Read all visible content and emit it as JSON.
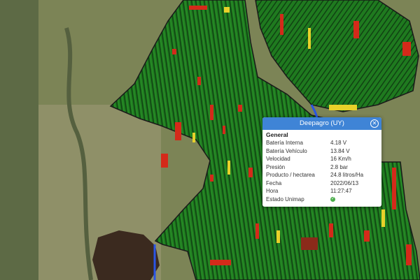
{
  "map": {
    "colors": {
      "field": "#1f7a1f",
      "row_dark": "#0f3e12",
      "row_light": "#2c9a2c",
      "rate_high": "#d42a1a",
      "rate_mid": "#e8d12a",
      "pasture": "#7c8456",
      "forest": "#3b2a1f",
      "route": "#2a55e6"
    }
  },
  "popup": {
    "title": "Deepagro (UY)",
    "close_icon": "close-icon",
    "section": "General",
    "rows": [
      {
        "label": "Batería Interna",
        "value": "4.18 V"
      },
      {
        "label": "Batería Vehículo",
        "value": "13.84 V"
      },
      {
        "label": "Velocidad",
        "value": "16 Km/h"
      },
      {
        "label": "Presión",
        "value": "2.8 bar"
      },
      {
        "label": "Producto / hectarea",
        "value": "24.8 litros/Ha"
      },
      {
        "label": "Fecha",
        "value": "2022/06/13"
      },
      {
        "label": "Hora",
        "value": "11:27:47"
      },
      {
        "label": "Estado Unimap",
        "value": "",
        "icon": "check-circle-icon",
        "status_color": "#4cae4c"
      }
    ]
  }
}
